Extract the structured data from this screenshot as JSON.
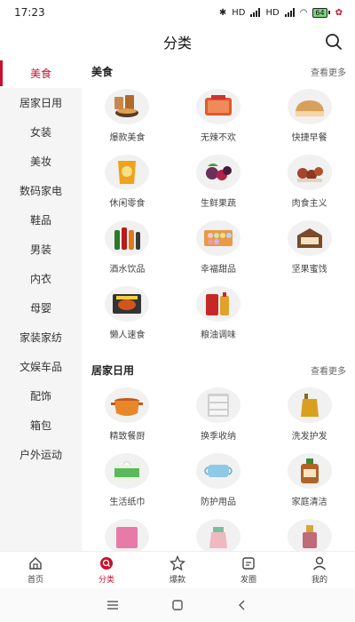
{
  "status": {
    "time": "17:23",
    "net1": "HD",
    "net2": "HD",
    "battery": "64"
  },
  "header": {
    "title": "分类"
  },
  "sidebar": {
    "items": [
      {
        "label": "美食",
        "active": true
      },
      {
        "label": "居家日用"
      },
      {
        "label": "女装"
      },
      {
        "label": "美妆"
      },
      {
        "label": "数码家电"
      },
      {
        "label": "鞋品"
      },
      {
        "label": "男装"
      },
      {
        "label": "内衣"
      },
      {
        "label": "母婴"
      },
      {
        "label": "家装家纺"
      },
      {
        "label": "文娱车品"
      },
      {
        "label": "配饰"
      },
      {
        "label": "箱包"
      },
      {
        "label": "户外运动"
      }
    ]
  },
  "sections": [
    {
      "title": "美食",
      "more": "查看更多",
      "items": [
        {
          "label": "爆款美食",
          "icon": "snack-bowl-icon",
          "color": "#c9874a"
        },
        {
          "label": "无辣不欢",
          "icon": "spicy-meat-icon",
          "color": "#e2572c"
        },
        {
          "label": "快捷早餐",
          "icon": "bread-icon",
          "color": "#d9a05b"
        },
        {
          "label": "休闲零食",
          "icon": "chips-bag-icon",
          "color": "#f0a21a"
        },
        {
          "label": "生鲜果蔬",
          "icon": "fruit-icon",
          "color": "#6b2f5a"
        },
        {
          "label": "肉食主义",
          "icon": "meatballs-icon",
          "color": "#a3472c"
        },
        {
          "label": "酒水饮品",
          "icon": "bottles-icon",
          "color": "#b71c1c"
        },
        {
          "label": "幸福甜品",
          "icon": "macaron-box-icon",
          "color": "#e89a4a"
        },
        {
          "label": "坚果蜜饯",
          "icon": "nut-box-icon",
          "color": "#7a4a2a"
        },
        {
          "label": "懒人速食",
          "icon": "noodle-pack-icon",
          "color": "#333333"
        },
        {
          "label": "粮油调味",
          "icon": "oil-rice-icon",
          "color": "#e0a22a"
        }
      ]
    },
    {
      "title": "居家日用",
      "more": "查看更多",
      "items": [
        {
          "label": "精致餐厨",
          "icon": "pot-icon",
          "color": "#e8862a"
        },
        {
          "label": "换季收纳",
          "icon": "drawer-icon",
          "color": "#cfcfcf"
        },
        {
          "label": "洗发护发",
          "icon": "shampoo-icon",
          "color": "#d9a020"
        },
        {
          "label": "生活纸巾",
          "icon": "tissue-icon",
          "color": "#5cb85c"
        },
        {
          "label": "防护用品",
          "icon": "mask-icon",
          "color": "#8ec9e8"
        },
        {
          "label": "家庭清洁",
          "icon": "disinfectant-icon",
          "color": "#b0642a"
        },
        {
          "label": "",
          "icon": "pink-pack-icon",
          "color": "#e87aa8"
        },
        {
          "label": "",
          "icon": "kettle-icon",
          "color": "#f0b8c0"
        },
        {
          "label": "",
          "icon": "perfume-icon",
          "color": "#c06a7a"
        }
      ]
    }
  ],
  "tabbar": {
    "items": [
      {
        "label": "首页",
        "icon": "home-icon"
      },
      {
        "label": "分类",
        "icon": "category-search-icon",
        "active": true
      },
      {
        "label": "爆款",
        "icon": "star-icon"
      },
      {
        "label": "发圈",
        "icon": "post-icon"
      },
      {
        "label": "我的",
        "icon": "user-icon"
      }
    ]
  },
  "colors": {
    "accent": "#c8102e",
    "sidebar_bg": "#f5f5f5"
  }
}
